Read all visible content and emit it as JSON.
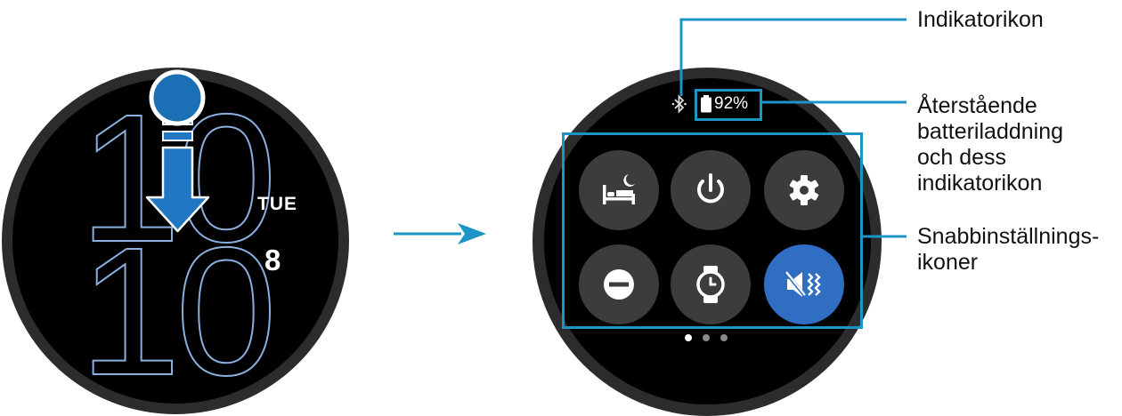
{
  "watch_face": {
    "hour": "10",
    "minute": "10",
    "day": "TUE",
    "date": "8"
  },
  "quick_panel": {
    "battery_percent": "92%",
    "buttons": [
      {
        "icon": "bedtime-icon",
        "active": false
      },
      {
        "icon": "power-icon",
        "active": false
      },
      {
        "icon": "settings-gear-icon",
        "active": false
      },
      {
        "icon": "do-not-disturb-icon",
        "active": false
      },
      {
        "icon": "watch-only-icon",
        "active": false
      },
      {
        "icon": "sound-mute-vibrate-icon",
        "active": true
      }
    ],
    "page_count": 3,
    "current_page": 1
  },
  "callouts": {
    "indicator": "Indikatorikon",
    "battery": [
      "Återstående",
      "batteriladdning",
      "och dess",
      "indikatorikon"
    ],
    "quick_settings": [
      "Snabbinställnings-",
      "ikoner"
    ]
  },
  "colors": {
    "callout_line": "#1d94c6",
    "touch_point": "#1a6fb5",
    "active_button": "#2f6ec2",
    "digit_outline": "#8ab0e0"
  }
}
